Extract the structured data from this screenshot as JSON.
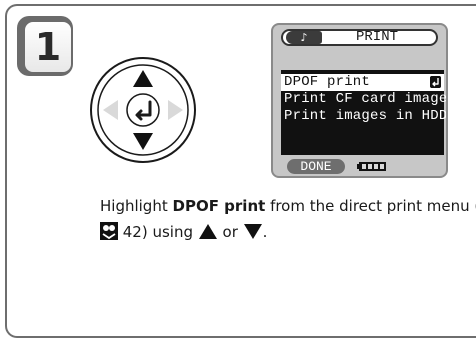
{
  "step": {
    "number": "1"
  },
  "lcd": {
    "tab_symbol": "♪",
    "title": "PRINT",
    "menu": [
      {
        "label": "DPOF print",
        "selected": true
      },
      {
        "label": "Print CF card images",
        "selected": false
      },
      {
        "label": "Print images in HDD",
        "selected": false
      }
    ],
    "done_label": "DONE"
  },
  "instruction": {
    "prefix": "Highlight ",
    "highlight": "DPOF print",
    "middle": " from the direct print menu (",
    "page_ref": " 42) using ",
    "or_text": " or ",
    "suffix": "."
  },
  "icons": {
    "dpad": "multi-selector-dpad-icon",
    "ref": "reference-page-icon",
    "up": "up-triangle-icon",
    "down": "down-triangle-icon",
    "enter": "enter-icon",
    "battery": "battery-icon"
  },
  "colors": {
    "panel_border": "#6e6e6e",
    "lcd_background": "#c7c7c7",
    "menu_background": "#111111",
    "selection": "#ffffff",
    "text": "#1a1a1a"
  }
}
